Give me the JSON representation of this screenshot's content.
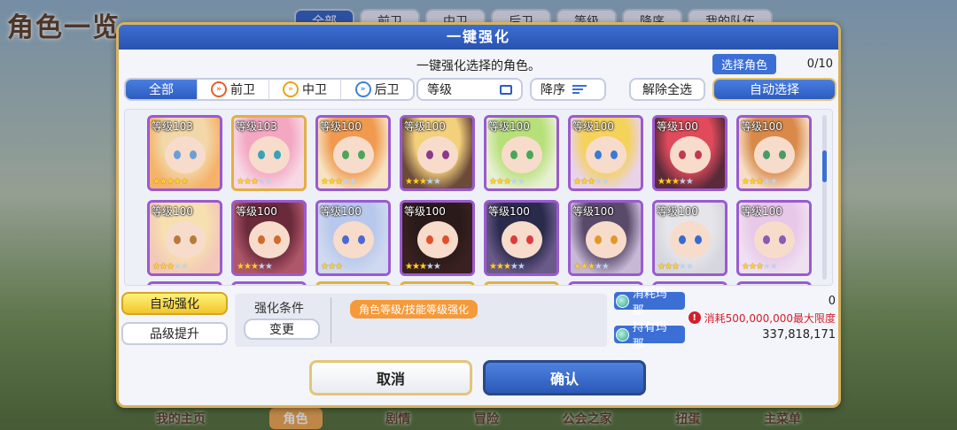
{
  "background": {
    "title": "角色一览",
    "tabs": [
      "全部",
      "前卫",
      "中卫",
      "后卫",
      "等级",
      "降序",
      "我的队伍"
    ],
    "nav": [
      "我的主页",
      "角色",
      "剧情",
      "冒险",
      "公会之家",
      "扭蛋",
      "主菜单"
    ],
    "active_nav": "角色"
  },
  "dialog": {
    "title": "一键强化",
    "subtitle": "一键强化选择的角色。",
    "select_label": "选择角色",
    "select_count": "0/10"
  },
  "filters": {
    "tabs": [
      {
        "label": "全部",
        "icon": null,
        "active": true
      },
      {
        "label": "前卫",
        "icon": "front-icon"
      },
      {
        "label": "中卫",
        "icon": "mid-icon"
      },
      {
        "label": "后卫",
        "icon": "back-icon"
      }
    ],
    "sort_label": "等级",
    "order_label": "降序",
    "clear_label": "解除全选",
    "auto_select_label": "自动选择"
  },
  "characters": [
    {
      "level": "等级103",
      "stars": 5,
      "frame": "purple",
      "hair": "#f2d7a8",
      "eye": "#6b9fd6",
      "bg": "#f5b26a"
    },
    {
      "level": "等级103",
      "stars": 3,
      "frame": "gold",
      "hair": "#f4a7c2",
      "eye": "#39a2b8",
      "bg": "#f7d9e6"
    },
    {
      "level": "等级100",
      "stars": 3,
      "frame": "purple",
      "hair": "#f19a4f",
      "eye": "#4aa65a",
      "bg": "#f6e3c2"
    },
    {
      "level": "等级100",
      "stars": 3,
      "frame": "purple",
      "hair": "#f3d07a",
      "eye": "#8a3a8a",
      "bg": "#6b4a3a"
    },
    {
      "level": "等级100",
      "stars": 3,
      "frame": "purple",
      "hair": "#b8e07a",
      "eye": "#4aa65a",
      "bg": "#e7f0d2"
    },
    {
      "level": "等级100",
      "stars": 3,
      "frame": "purple",
      "hair": "#f5d25a",
      "eye": "#3a7ad6",
      "bg": "#e8d3e9"
    },
    {
      "level": "等级100",
      "stars": 3,
      "frame": "purple",
      "hair": "#e04a5a",
      "eye": "#c23a4a",
      "bg": "#5a2a3a"
    },
    {
      "level": "等级100",
      "stars": 3,
      "frame": "purple",
      "hair": "#d98a4a",
      "eye": "#4a9a6a",
      "bg": "#f6dfc6"
    },
    {
      "level": "等级100",
      "stars": 3,
      "frame": "purple",
      "hair": "#f6e0b0",
      "eye": "#b87a3a",
      "bg": "#f3c8b8"
    },
    {
      "level": "等级100",
      "stars": 3,
      "frame": "purple",
      "hair": "#6a2a3a",
      "eye": "#d06a2a",
      "bg": "#b0566a"
    },
    {
      "level": "等级100",
      "stars": 3,
      "frame": "purple",
      "hair": "#b8c8ec",
      "eye": "#4a6ad0",
      "bg": "#cfd9ef"
    },
    {
      "level": "等级100",
      "stars": 3,
      "frame": "purple",
      "hair": "#2a1a1a",
      "eye": "#e0502a",
      "bg": "#3a2020"
    },
    {
      "level": "等级100",
      "stars": 3,
      "frame": "purple",
      "hair": "#2a2a4a",
      "eye": "#e03a3a",
      "bg": "#6a5a8a"
    },
    {
      "level": "等级100",
      "stars": 3,
      "frame": "purple",
      "hair": "#5a4a6a",
      "eye": "#e09a2a",
      "bg": "#c7b8d6"
    },
    {
      "level": "等级100",
      "stars": 3,
      "frame": "purple",
      "hair": "#e6e6ea",
      "eye": "#3a6ad0",
      "bg": "#d6d6de"
    },
    {
      "level": "等级100",
      "stars": 3,
      "frame": "purple",
      "hair": "#e8c8e8",
      "eye": "#8a5ab8",
      "bg": "#efe0f2"
    }
  ],
  "row3_frames": [
    "purple",
    "purple",
    "gold",
    "gold",
    "gold",
    "purple",
    "purple",
    "purple"
  ],
  "side_buttons": {
    "auto_label": "自动强化",
    "grade_label": "品级提升"
  },
  "conditions": {
    "title": "强化条件",
    "change_label": "变更",
    "tag": "角色等级/技能等级强化"
  },
  "mana": {
    "consume_label": "消耗玛那",
    "consume_value": "0",
    "warning": "消耗500,000,000最大限度",
    "own_label": "持有玛那",
    "own_value": "337,818,171"
  },
  "actions": {
    "cancel_label": "取消",
    "confirm_label": "确认"
  }
}
